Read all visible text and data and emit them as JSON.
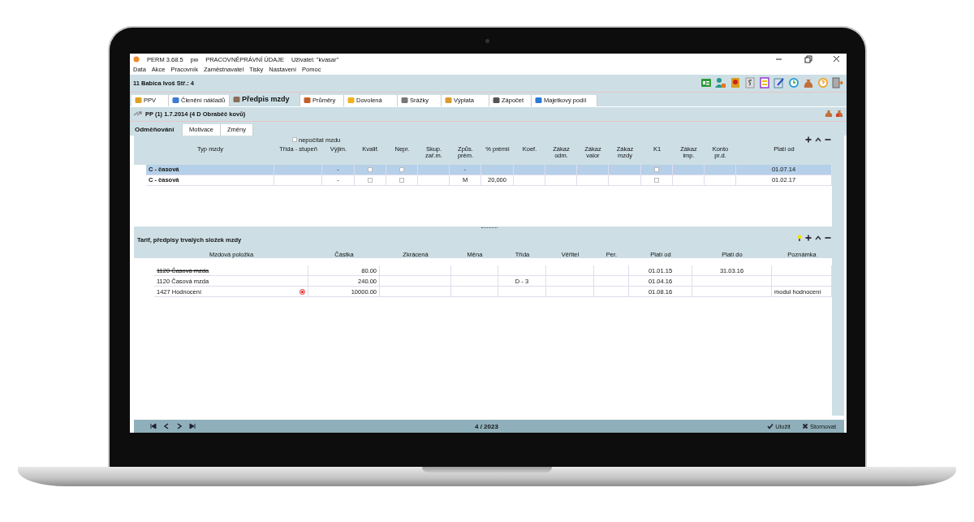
{
  "window": {
    "app": "PERM 3.68.5",
    "user_code": "pw",
    "module": "PRACOVNĚPRÁVNÍ ÚDAJE",
    "user": "Uživatel: \"kvasar\""
  },
  "menu": [
    "Data",
    "Akce",
    "Pracovník",
    "Zaměstnavatel",
    "Tisky",
    "Nastavení",
    "Pomoc"
  ],
  "employee": "11  Babica Ivoš Stř.: 4",
  "tabs": [
    {
      "label": "PPV",
      "selected": false
    },
    {
      "label": "Členění nákladů",
      "selected": false
    },
    {
      "label": "Předpis mzdy",
      "selected": true
    },
    {
      "label": "Průměry",
      "selected": false
    },
    {
      "label": "Dovolená",
      "selected": false
    },
    {
      "label": "Srážky",
      "selected": false
    },
    {
      "label": "Výplata",
      "selected": false
    },
    {
      "label": "Zápočet",
      "selected": false
    },
    {
      "label": "Majetkový podíl",
      "selected": false
    }
  ],
  "contract": "PP (1) 1.7.2014 (4 D Obraběč kovů)",
  "subtabs": [
    {
      "label": "Odměňování",
      "selected": true
    },
    {
      "label": "Motivace",
      "selected": false
    },
    {
      "label": "Změny",
      "selected": false
    }
  ],
  "wage_types": {
    "option": {
      "label": "nepočítat mzdu",
      "checked": false
    },
    "columns": [
      "Typ mzdy",
      "Třída - stupeň",
      "Výjim.",
      "Kvalif.",
      "Nepr.",
      "Skup.\nzař.m.",
      "Způs.\nprém.",
      "% prémií",
      "Koef.",
      "Zákaz\nodm.",
      "Zákaz\nvalor",
      "Zákaz\nmzdy",
      "K1",
      "Zákaz\nimp.",
      "Konto\npr.d.",
      "Platí od"
    ],
    "rows": [
      {
        "selected": true,
        "cells": [
          {
            "kind": "text",
            "text": "C - časová"
          },
          {
            "kind": "empty"
          },
          {
            "kind": "text",
            "text": "-"
          },
          {
            "kind": "check",
            "checked": false
          },
          {
            "kind": "check",
            "checked": false
          },
          {
            "kind": "empty"
          },
          {
            "kind": "text",
            "text": "-"
          },
          {
            "kind": "empty"
          },
          {
            "kind": "empty"
          },
          {
            "kind": "empty"
          },
          {
            "kind": "empty"
          },
          {
            "kind": "empty"
          },
          {
            "kind": "check",
            "checked": false
          },
          {
            "kind": "empty"
          },
          {
            "kind": "empty"
          },
          {
            "kind": "text",
            "text": "01.07.14"
          }
        ]
      },
      {
        "selected": false,
        "cells": [
          {
            "kind": "text",
            "text": "C - časová"
          },
          {
            "kind": "empty"
          },
          {
            "kind": "text",
            "text": "-"
          },
          {
            "kind": "check",
            "checked": false
          },
          {
            "kind": "check",
            "checked": false
          },
          {
            "kind": "empty"
          },
          {
            "kind": "text",
            "text": "M"
          },
          {
            "kind": "text",
            "text": "20,000"
          },
          {
            "kind": "empty"
          },
          {
            "kind": "empty"
          },
          {
            "kind": "empty"
          },
          {
            "kind": "empty"
          },
          {
            "kind": "check",
            "checked": false
          },
          {
            "kind": "empty"
          },
          {
            "kind": "empty"
          },
          {
            "kind": "text",
            "text": "01.02.17"
          }
        ]
      }
    ]
  },
  "components": {
    "title": "Tarif, předpisy trvalých složek mzdy",
    "columns": [
      "Mzdová položka",
      "Částka",
      "Zkrácená",
      "Měna",
      "Třída",
      "Věřitel",
      "Per.",
      "Platí od",
      "Platí do",
      "Poznámka"
    ],
    "rows": [
      {
        "struck": true,
        "marked": false,
        "cells": [
          "1120 Časová mzda",
          "80.00",
          "",
          "",
          "",
          "",
          "",
          "01.01.15",
          "31.03.16",
          ""
        ]
      },
      {
        "struck": false,
        "marked": false,
        "cells": [
          "1120 Časová mzda",
          "240.00",
          "",
          "",
          "D - 3",
          "",
          "",
          "01.04.16",
          "",
          ""
        ]
      },
      {
        "struck": false,
        "marked": true,
        "cells": [
          "1427 Hodnocení",
          "10000.00",
          "",
          "",
          "",
          "",
          "",
          "01.08.16",
          "",
          "modul hodnocení"
        ]
      }
    ]
  },
  "footer": {
    "period": "4 / 2023",
    "buttons": [
      "Uložit",
      "Stornovat"
    ]
  }
}
